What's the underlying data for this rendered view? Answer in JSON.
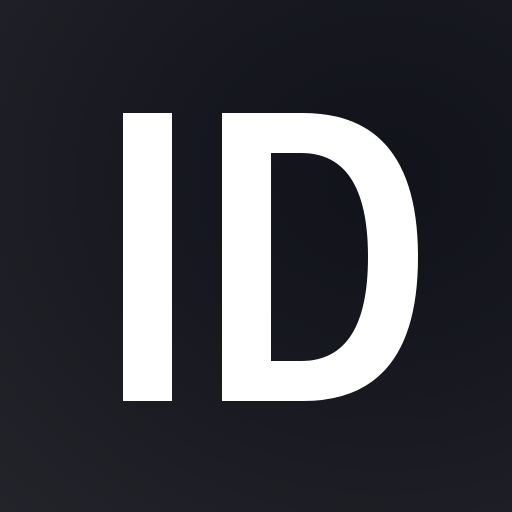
{
  "app_icon": {
    "lettering": "ID",
    "letter_color": "#ffffff",
    "background_colors": [
      "#11121a",
      "#23242a"
    ]
  }
}
